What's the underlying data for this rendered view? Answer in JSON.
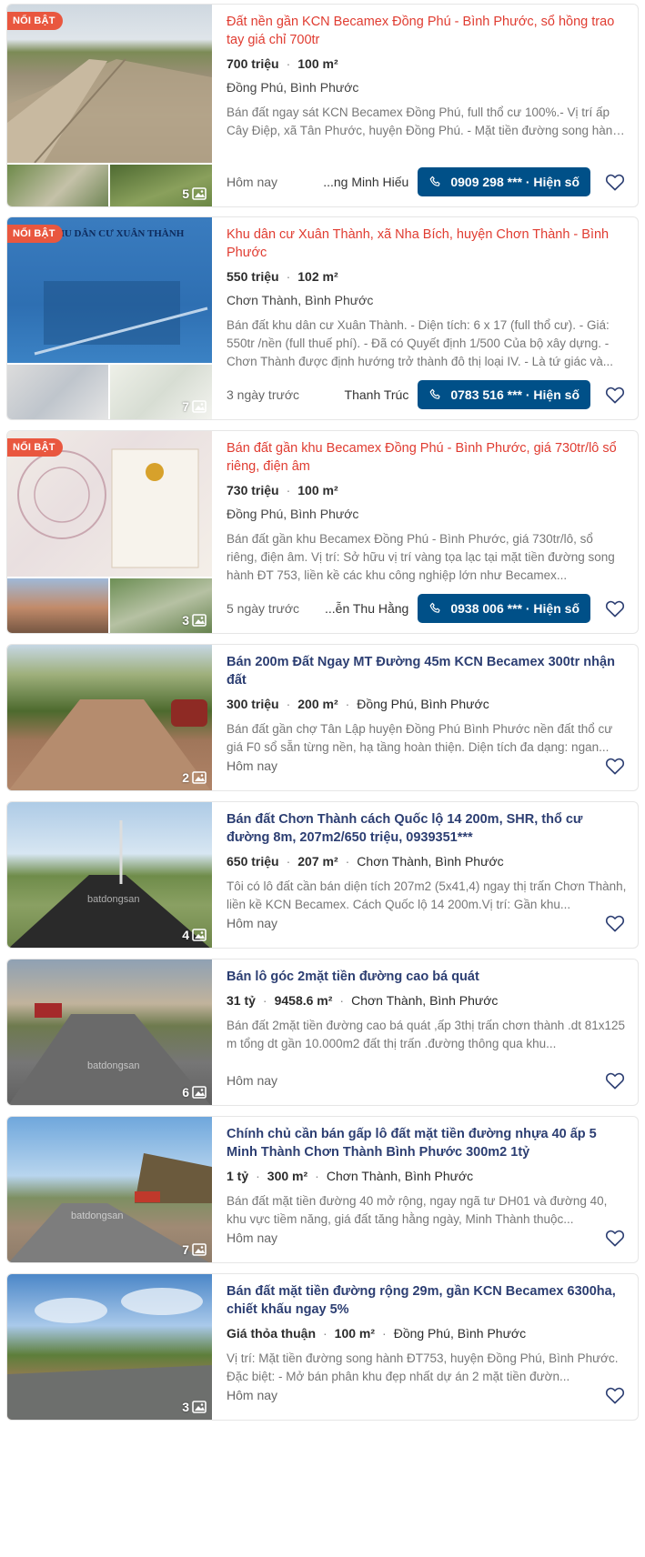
{
  "listings": [
    {
      "badge": "NỔI BẬT",
      "title": "Đất nền gần KCN Becamex Đồng Phú - Bình Phước, sổ hồng trao tay giá chỉ 700tr",
      "price": "700 triệu",
      "area": "100 m²",
      "location": "Đồng Phú, Bình Phước",
      "description": "Bán đất ngay sát KCN Becamex Đồng Phú, full thổ cư 100%.- Vị trí ấp Cây Điệp, xã Tân Phước, huyện Đồng Phú. - Mặt tiền đường song hành thuộc tỉnh lộ ĐT753. - Ngay khu dân cư đông đúc, sát ngay chợ Tân...",
      "date": "Hôm nay",
      "agent": "...ng Minh Hiếu",
      "phone": "0909 298 *** · Hiện số",
      "photo_count": "5"
    },
    {
      "badge": "NỔI BẬT",
      "title": "Khu dân cư Xuân Thành, xã Nha Bích, huyện Chơn Thành - Bình Phước",
      "price": "550 triệu",
      "area": "102 m²",
      "location": "Chơn Thành, Bình Phước",
      "description": "Bán đất khu dân cư Xuân Thành. - Diện tích: 6 x 17 (full thổ cư). - Giá: 550tr /nền (full thuế phí). - Đã có Quyết định 1/500 Của bộ xây dựng. - Chơn Thành được định hướng trở thành đô thị loại IV. - Là tứ giác và...",
      "date": "3 ngày trước",
      "agent": "Thanh Trúc",
      "phone": "0783 516 *** · Hiện số",
      "photo_count": "7",
      "image_text": "KHU DÂN CƯ XUÂN THÀNH"
    },
    {
      "badge": "NỔI BẬT",
      "title": "Bán đất gần khu Becamex Đồng Phú - Bình Phước, giá 730tr/lô sổ riêng, điện âm",
      "price": "730 triệu",
      "area": "100 m²",
      "location": "Đồng Phú, Bình Phước",
      "description": "Bán đất gần khu Becamex Đồng Phú - Bình Phước, giá 730tr/lô, sổ riêng, điện âm. Vị trí: Sở hữu vị trí vàng tọa lạc tại mặt tiền đường song hành ĐT 753, liền kề các khu công nghiệp lớn như Becamex...",
      "date": "5 ngày trước",
      "agent": "...ễn Thu Hằng",
      "phone": "0938 006 *** · Hiện số",
      "photo_count": "3"
    },
    {
      "title": "Bán 200m Đất Ngay MT Đường 45m KCN Becamex 300tr nhận đất",
      "price": "300 triệu",
      "area": "200 m²",
      "location": "Đồng Phú, Bình Phước",
      "description": "Bán đất gần chợ Tân Lập huyện Đồng Phú Bình Phước nền đất thổ cư giá F0 sổ sẵn từng nền, hạ tầng hoàn thiện. Diện tích đa dạng: ngan...",
      "date": "Hôm nay",
      "photo_count": "2"
    },
    {
      "title": "Bán đất Chơn Thành cách Quốc lộ 14 200m, SHR, thổ cư đường 8m, 207m2/650 triệu, 0939351***",
      "price": "650 triệu",
      "area": "207 m²",
      "location": "Chơn Thành, Bình Phước",
      "description": "Tôi có lô đất cần bán diện tích 207m2 (5x41,4) ngay thị trấn Chơn Thành, liền kề KCN Becamex. Cách Quốc lộ 14 200m.Vị trí: Gần khu...",
      "date": "Hôm nay",
      "photo_count": "4"
    },
    {
      "title": "Bán lô góc 2mặt tiền đường cao bá quát",
      "price": "31 tỷ",
      "area": "9458.6 m²",
      "location": "Chơn Thành, Bình Phước",
      "description": "Bán đất 2mặt tiền đường cao bá quát ,ấp 3thị trấn chơn thành .dt 81x125 m tổng dt gần 10.000m2 đất thị trấn .đường thông qua khu...",
      "date": "Hôm nay",
      "photo_count": "6"
    },
    {
      "title": "Chính chủ cần bán gấp lô đất mặt tiền đường nhựa 40 ấp 5 Minh Thành Chơn Thành Bình Phước 300m2 1tỷ",
      "price": "1 tỷ",
      "area": "300 m²",
      "location": "Chơn Thành, Bình Phước",
      "description": "Bán đất mặt tiền đường 40 mở rộng, ngay ngã tư DH01 và đường 40, khu vực tiềm năng, giá đất tăng hằng ngày, Minh Thành thuộc...",
      "date": "Hôm nay",
      "photo_count": "7"
    },
    {
      "title": "Bán đất mặt tiền đường rộng 29m, gần KCN Becamex 6300ha, chiết khấu ngay 5%",
      "price": "Giá thỏa thuận",
      "area": "100 m²",
      "location": "Đồng Phú, Bình Phước",
      "description": "Vị trí: Mặt tiền đường song hành ĐT753, huyện Đồng Phú, Bình Phước. Đặc biệt: - Mở bán phân khu đẹp nhất dự án 2 mặt tiền đườn...",
      "date": "Hôm nay",
      "photo_count": "3"
    }
  ],
  "watermark": "batdongsan",
  "colors": {
    "badge": "#e9573f",
    "vip_title": "#e03c31",
    "std_title": "#2c3e72",
    "phone_button": "#005088",
    "heart": "#2c3e72"
  },
  "icons": {
    "phone": "phone-icon",
    "heart": "heart-icon",
    "photos": "image-icon"
  }
}
